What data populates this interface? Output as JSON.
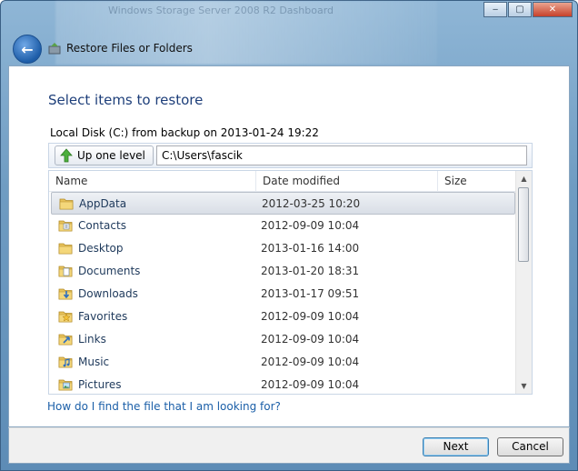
{
  "window": {
    "title": "Restore Files or Folders",
    "background_title": "Windows Storage Server 2008 R2 Dashboard",
    "controls": {
      "minimize": "‒",
      "maximize": "▢",
      "close": "✕"
    }
  },
  "page": {
    "heading": "Select items to restore",
    "source": "Local Disk (C:) from backup on 2013-01-24 19:22",
    "up_button": "Up one level",
    "path": "C:\\Users\\fascik",
    "columns": {
      "name": "Name",
      "date": "Date modified",
      "size": "Size"
    },
    "items": [
      {
        "name": "AppData",
        "date": "2012-03-25 10:20",
        "icon": "folder-icon",
        "selected": true
      },
      {
        "name": "Contacts",
        "date": "2012-09-09 10:04",
        "icon": "contacts-folder-icon"
      },
      {
        "name": "Desktop",
        "date": "2013-01-16 14:00",
        "icon": "folder-icon"
      },
      {
        "name": "Documents",
        "date": "2013-01-20 18:31",
        "icon": "documents-folder-icon"
      },
      {
        "name": "Downloads",
        "date": "2013-01-17 09:51",
        "icon": "downloads-folder-icon"
      },
      {
        "name": "Favorites",
        "date": "2012-09-09 10:04",
        "icon": "favorites-folder-icon"
      },
      {
        "name": "Links",
        "date": "2012-09-09 10:04",
        "icon": "links-folder-icon"
      },
      {
        "name": "Music",
        "date": "2012-09-09 10:04",
        "icon": "music-folder-icon"
      },
      {
        "name": "Pictures",
        "date": "2012-09-09 10:04",
        "icon": "pictures-folder-icon"
      }
    ],
    "help_link": "How do I find the file that I am looking for?"
  },
  "footer": {
    "next": "Next",
    "cancel": "Cancel"
  },
  "colors": {
    "heading": "#1e3f7a",
    "link": "#1b5fa8",
    "folder": "#e8c25a",
    "frame": "#6f9cc2"
  }
}
